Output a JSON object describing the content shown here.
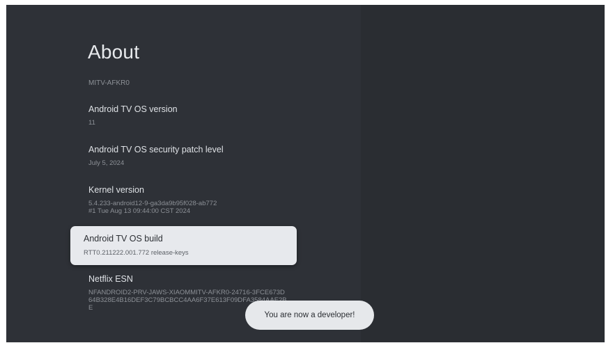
{
  "page": {
    "title": "About",
    "device_name": "MITV-AFKR0"
  },
  "items": {
    "os_version": {
      "label": "Android TV OS version",
      "value": "11"
    },
    "security_patch": {
      "label": "Android TV OS security patch level",
      "value": "July 5, 2024"
    },
    "kernel": {
      "label": "Kernel version",
      "value": "5.4.233-android12-9-ga3da9b95f028-ab772\n#1 Tue Aug 13 09:44:00 CST 2024"
    },
    "os_build": {
      "label": "Android TV OS build",
      "value": "RTT0.211222.001.772 release-keys"
    },
    "netflix_esn": {
      "label": "Netflix ESN",
      "value": "NFANDROID2-PRV-JAWS-XIAOMMITV-AFKR0-24716-3FCE673D64B328E4B16DEF3C79BCBCC4AA6F37​E613F09DFA3584AAE2BE"
    }
  },
  "toast": {
    "message": "You are now a developer!"
  },
  "colors": {
    "panel": "#2e3137",
    "background": "#2a2d32",
    "focus": "#e7e9ed"
  }
}
